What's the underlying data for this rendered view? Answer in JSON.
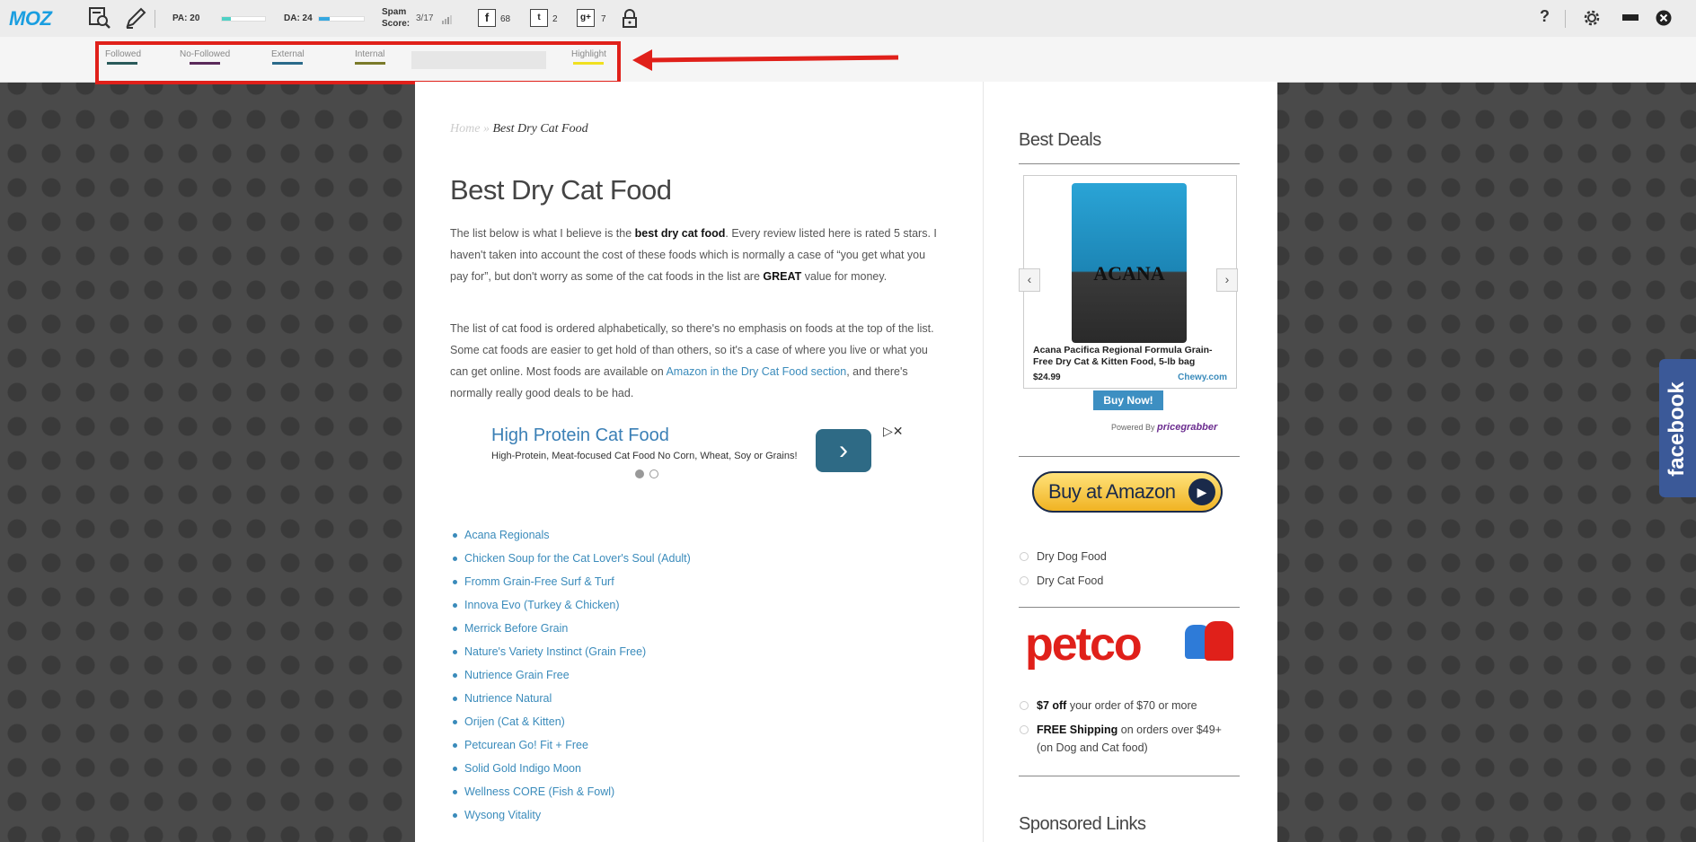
{
  "mozbar": {
    "logo": "MOZ",
    "pa_label": "PA: 20",
    "pa_fraction": 0.2,
    "da_label": "DA: 24",
    "da_fraction": 0.24,
    "spam_label_1": "Spam",
    "spam_label_2": "Score:",
    "spam_value": "3/17",
    "facebook_count": "68",
    "twitter_count": "2",
    "gplus_count": "7",
    "help_label": "?",
    "icons": [
      "page-analysis-icon",
      "highlighter-icon",
      "lock-icon",
      "gear-icon",
      "minimize-icon",
      "close-icon"
    ]
  },
  "legend": {
    "items": [
      {
        "label": "Followed",
        "color": "#2a5a5a"
      },
      {
        "label": "No-Followed",
        "color": "#5a2a5a"
      },
      {
        "label": "External",
        "color": "#2a6a8a"
      },
      {
        "label": "Internal",
        "color": "#7a7a2a"
      }
    ],
    "highlight_label": "Highlight",
    "highlight_color": "#f0e020"
  },
  "annotation": {
    "box_color": "#e0201a"
  },
  "page": {
    "breadcrumb_home": "Home",
    "breadcrumb_sep": "»",
    "breadcrumb_current": "Best Dry Cat Food",
    "title": "Best Dry Cat Food",
    "para1_a": "The list below is what I believe is the ",
    "para1_b": "best dry cat food",
    "para1_c": ". Every review listed here is rated 5 stars. I haven't taken into account the cost of these foods which is normally a case of “you get what you pay for”, but don't worry as some of the cat foods in the list are ",
    "para1_d": "GREAT",
    "para1_e": " value for money.",
    "para2_a": "The list of cat food is ordered alphabetically, so there's no emphasis on foods at the top of the list. Some cat foods are easier to get hold of than others, so it's a case of where you live or what you can get online. Most foods are available on ",
    "para2_link": "Amazon in the Dry Cat Food section",
    "para2_b": ", and there's normally really good deals to be had.",
    "ad_title": "High Protein Cat Food",
    "ad_sub": "High-Protein, Meat-focused Cat Food No Corn, Wheat, Soy or Grains!",
    "foods": [
      "Acana Regionals",
      "Chicken Soup for the Cat Lover's Soul (Adult)",
      "Fromm Grain-Free Surf & Turf",
      "Innova Evo (Turkey & Chicken)",
      "Merrick Before Grain",
      "Nature's Variety Instinct (Grain Free)",
      "Nutrience Grain Free",
      "Nutrience Natural",
      "Orijen (Cat & Kitten)",
      "Petcurean Go! Fit + Free",
      "Solid Gold Indigo Moon",
      "Wellness CORE (Fish & Fowl)",
      "Wysong Vitality"
    ]
  },
  "sidebar": {
    "best_deals": "Best Deals",
    "bag_name": "ACANA",
    "product_desc": "Acana Pacifica Regional Formula Grain-Free Dry Cat & Kitten Food, 5-lb bag",
    "price": "$24.99",
    "store": "Chewy.com",
    "buy_now": "Buy Now!",
    "powered_by": "Powered By",
    "pricegrabber": "pricegrabber",
    "amazon_button": "Buy at Amazon",
    "links": [
      "Dry Dog Food",
      "Dry Cat Food"
    ],
    "petco_logo": "petco",
    "deal1_bold": "$7 off",
    "deal1_rest": " your order of $70 or more",
    "deal2_bold": "FREE Shipping",
    "deal2_rest": " on orders over $49+ (on Dog and Cat food)",
    "sponsored": "Sponsored Links"
  },
  "facebook_tab": "facebook"
}
